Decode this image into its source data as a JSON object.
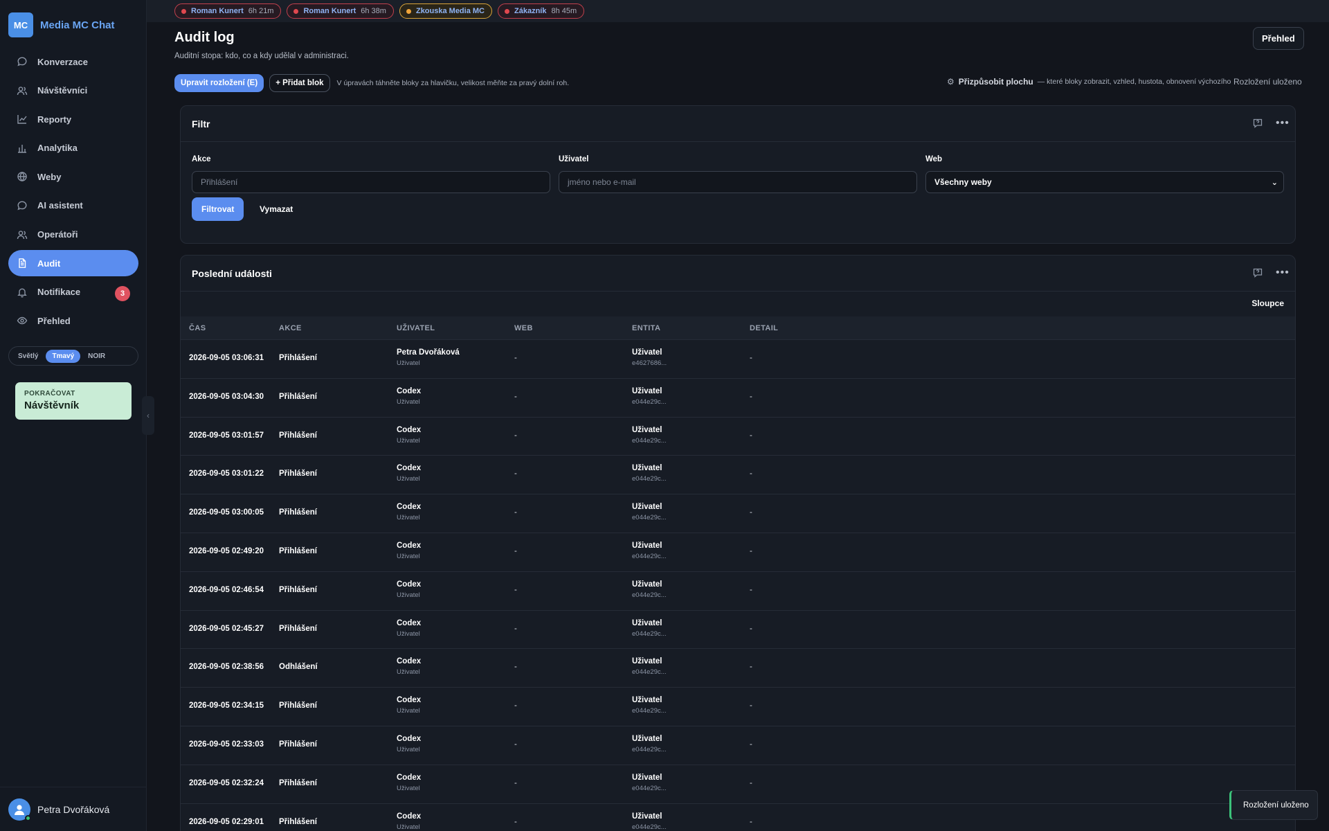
{
  "brand": {
    "logo": "MC",
    "name": "Media MC Chat"
  },
  "sidebar": {
    "items": [
      {
        "label": "Konverzace",
        "icon": "chat-icon"
      },
      {
        "label": "Návštěvníci",
        "icon": "users-icon"
      },
      {
        "label": "Reporty",
        "icon": "chart-line-icon"
      },
      {
        "label": "Analytika",
        "icon": "bar-chart-icon"
      },
      {
        "label": "Weby",
        "icon": "globe-icon"
      },
      {
        "label": "AI asistent",
        "icon": "chat-icon"
      },
      {
        "label": "Operátoři",
        "icon": "users-icon"
      },
      {
        "label": "Audit",
        "icon": "document-icon",
        "active": true
      },
      {
        "label": "Notifikace",
        "icon": "bell-icon",
        "badge": "3"
      },
      {
        "label": "Přehled",
        "icon": "eye-icon"
      }
    ],
    "theme": {
      "options": [
        "Světlý",
        "Tmavý",
        "NOIR"
      ],
      "selected": "Tmavý"
    },
    "continue_card": {
      "small": "POKRAČOVAT",
      "big": "Návštěvník"
    },
    "user": {
      "name": "Petra Dvořáková"
    }
  },
  "chips": [
    {
      "name": "Roman Kunert",
      "time": "6h 21m",
      "status": "red"
    },
    {
      "name": "Roman Kunert",
      "time": "6h 38m",
      "status": "red"
    },
    {
      "name": "Zkouska Media MC",
      "time": "",
      "status": "orange"
    },
    {
      "name": "Zákazník",
      "time": "8h 45m",
      "status": "red"
    }
  ],
  "header": {
    "title": "Audit log",
    "subtitle": "Auditní stopa: kdo, co a kdy udělal v administraci.",
    "overview_button": "Přehled"
  },
  "toolbar": {
    "edit_layout": "Upravit rozložení (E)",
    "add_block": "+ Přidat blok",
    "hint": "V úpravách táhněte bloky za hlavičku, velikost měňte za pravý dolní roh.",
    "customize_label": "Přizpůsobit plochu",
    "customize_desc": "— které bloky zobrazit, vzhled, hustota, obnovení výchozího",
    "layout_saved": "Rozložení uloženo"
  },
  "filter": {
    "title": "Filtr",
    "action_label": "Akce",
    "action_placeholder": "Přihlášení",
    "user_label": "Uživatel",
    "user_placeholder": "jméno nebo e-mail",
    "web_label": "Web",
    "web_value": "Všechny weby",
    "filter_button": "Filtrovat",
    "clear_button": "Vymazat"
  },
  "events": {
    "title": "Poslední události",
    "columns_button": "Sloupce",
    "headers": [
      "ČAS",
      "AKCE",
      "UŽIVATEL",
      "WEB",
      "ENTITA",
      "DETAIL"
    ],
    "rows": [
      {
        "time": "2026-09-05 03:06:31",
        "action": "Přihlášení",
        "user": "Petra Dvořáková",
        "user_role": "Uživatel",
        "web": "-",
        "entity": "Uživatel",
        "entity_id": "e4627686...",
        "detail": "-"
      },
      {
        "time": "2026-09-05 03:04:30",
        "action": "Přihlášení",
        "user": "Codex",
        "user_role": "Uživatel",
        "web": "-",
        "entity": "Uživatel",
        "entity_id": "e044e29c...",
        "detail": "-"
      },
      {
        "time": "2026-09-05 03:01:57",
        "action": "Přihlášení",
        "user": "Codex",
        "user_role": "Uživatel",
        "web": "-",
        "entity": "Uživatel",
        "entity_id": "e044e29c...",
        "detail": "-"
      },
      {
        "time": "2026-09-05 03:01:22",
        "action": "Přihlášení",
        "user": "Codex",
        "user_role": "Uživatel",
        "web": "-",
        "entity": "Uživatel",
        "entity_id": "e044e29c...",
        "detail": "-"
      },
      {
        "time": "2026-09-05 03:00:05",
        "action": "Přihlášení",
        "user": "Codex",
        "user_role": "Uživatel",
        "web": "-",
        "entity": "Uživatel",
        "entity_id": "e044e29c...",
        "detail": "-"
      },
      {
        "time": "2026-09-05 02:49:20",
        "action": "Přihlášení",
        "user": "Codex",
        "user_role": "Uživatel",
        "web": "-",
        "entity": "Uživatel",
        "entity_id": "e044e29c...",
        "detail": "-"
      },
      {
        "time": "2026-09-05 02:46:54",
        "action": "Přihlášení",
        "user": "Codex",
        "user_role": "Uživatel",
        "web": "-",
        "entity": "Uživatel",
        "entity_id": "e044e29c...",
        "detail": "-"
      },
      {
        "time": "2026-09-05 02:45:27",
        "action": "Přihlášení",
        "user": "Codex",
        "user_role": "Uživatel",
        "web": "-",
        "entity": "Uživatel",
        "entity_id": "e044e29c...",
        "detail": "-"
      },
      {
        "time": "2026-09-05 02:38:56",
        "action": "Odhlášení",
        "user": "Codex",
        "user_role": "Uživatel",
        "web": "-",
        "entity": "Uživatel",
        "entity_id": "e044e29c...",
        "detail": "-"
      },
      {
        "time": "2026-09-05 02:34:15",
        "action": "Přihlášení",
        "user": "Codex",
        "user_role": "Uživatel",
        "web": "-",
        "entity": "Uživatel",
        "entity_id": "e044e29c...",
        "detail": "-"
      },
      {
        "time": "2026-09-05 02:33:03",
        "action": "Přihlášení",
        "user": "Codex",
        "user_role": "Uživatel",
        "web": "-",
        "entity": "Uživatel",
        "entity_id": "e044e29c...",
        "detail": "-"
      },
      {
        "time": "2026-09-05 02:32:24",
        "action": "Přihlášení",
        "user": "Codex",
        "user_role": "Uživatel",
        "web": "-",
        "entity": "Uživatel",
        "entity_id": "e044e29c...",
        "detail": "-"
      },
      {
        "time": "2026-09-05 02:29:01",
        "action": "Přihlášení",
        "user": "Codex",
        "user_role": "Uživatel",
        "web": "-",
        "entity": "Uživatel",
        "entity_id": "e044e29c...",
        "detail": "-"
      }
    ]
  },
  "toast": {
    "text": "Rozložení uloženo"
  }
}
